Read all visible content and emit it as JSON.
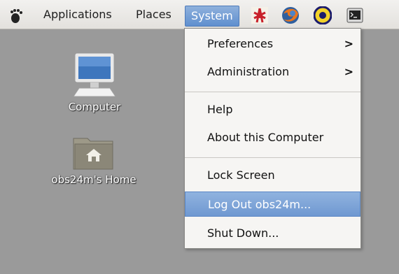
{
  "panel": {
    "menus": [
      "Applications",
      "Places",
      "System"
    ],
    "launchers": [
      {
        "icon": "app-launcher-icon"
      },
      {
        "icon": "firefox-icon"
      },
      {
        "icon": "yellow-circle-app-icon"
      },
      {
        "icon": "terminal-icon"
      }
    ]
  },
  "desktop": {
    "icons": [
      {
        "label": "Computer",
        "icon": "computer-icon"
      },
      {
        "label": "obs24m's Home",
        "icon": "home-folder-icon"
      }
    ]
  },
  "system_menu": {
    "items": [
      {
        "label": "Preferences",
        "submenu": true,
        "arrow": ">"
      },
      {
        "label": "Administration",
        "submenu": true,
        "arrow": ">"
      },
      {
        "label": "Help"
      },
      {
        "label": "About this Computer"
      },
      {
        "label": "Lock Screen"
      },
      {
        "label": "Log Out obs24m...",
        "selected": true
      },
      {
        "label": "Shut Down..."
      }
    ]
  },
  "colors": {
    "desktop_bg": "#9a9a9a",
    "panel_bg": "#eeece9",
    "selection": "#7fa3d6"
  }
}
